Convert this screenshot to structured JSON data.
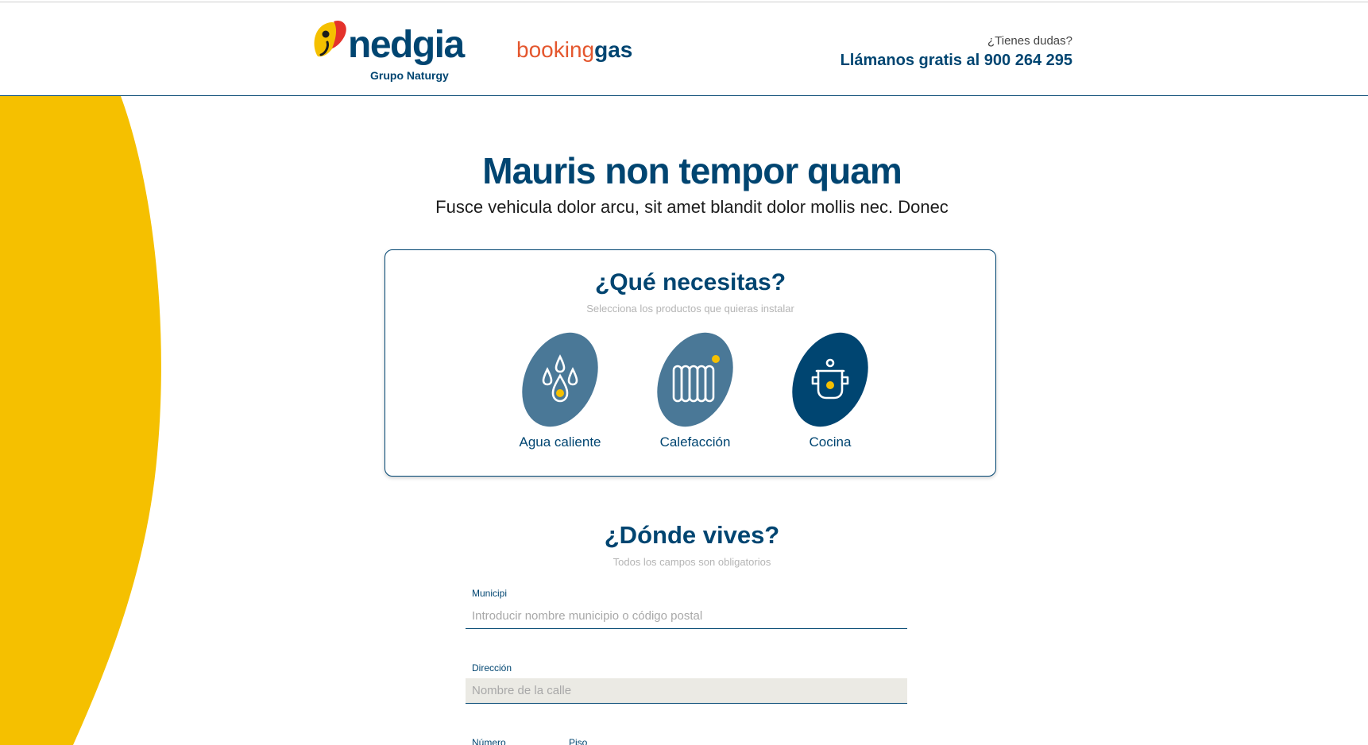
{
  "header": {
    "logo_word": "nedgia",
    "logo_sub": "Grupo Naturgy",
    "booking_part1": "booking",
    "booking_part2": "gas",
    "contact_question": "¿Tienes dudas?",
    "contact_phone": "Llámanos gratis al 900 264 295"
  },
  "hero": {
    "title": "Mauris non tempor quam",
    "subtitle": "Fusce vehicula dolor arcu, sit amet blandit dolor mollis nec. Donec"
  },
  "needs": {
    "title": "¿Qué necesitas?",
    "subtitle": "Selecciona los productos que quieras instalar",
    "products": [
      {
        "label": "Agua caliente",
        "icon": "water-drops-icon",
        "selected": false
      },
      {
        "label": "Calefacción",
        "icon": "radiator-icon",
        "selected": false
      },
      {
        "label": "Cocina",
        "icon": "cooking-pot-icon",
        "selected": true
      }
    ]
  },
  "address": {
    "title": "¿Dónde vives?",
    "subtitle": "Todos los campos son obligatorios",
    "municipality_label": "Municipi",
    "municipality_placeholder": "Introducir nombre municipio o código postal",
    "street_label": "Dirección",
    "street_placeholder": "Nombre de la calle",
    "number_label": "Número",
    "floor_label": "Piso"
  },
  "colors": {
    "primary": "#004571",
    "accent_yellow": "#f5c000",
    "product_idle": "#4a7897",
    "brand_orange": "#e4572e"
  }
}
